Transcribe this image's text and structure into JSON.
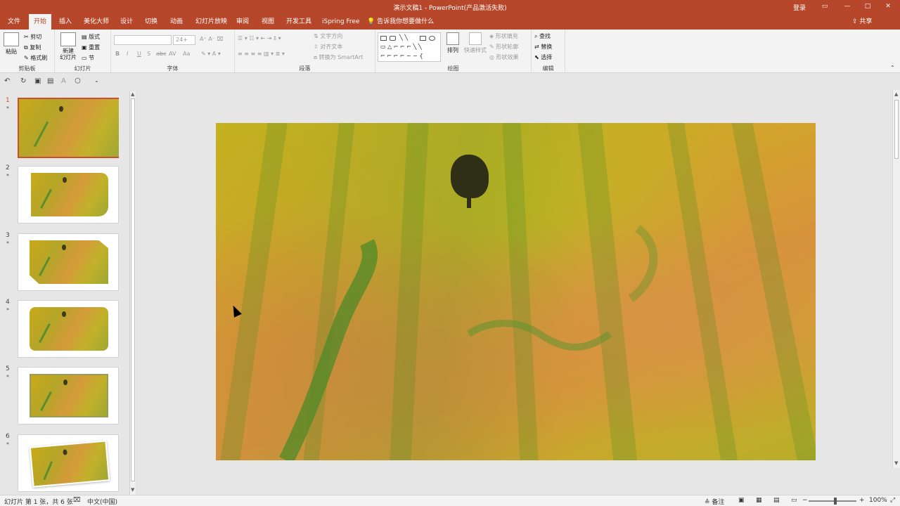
{
  "titlebar": {
    "title": "演示文稿1  -  PowerPoint(产品激活失败)",
    "login": "登录",
    "restore_icon": "ribbon-display-icon",
    "min": "—",
    "max": "□",
    "close": "✕"
  },
  "tabs": [
    "文件",
    "开始",
    "插入",
    "美化大师",
    "设计",
    "切换",
    "动画",
    "幻灯片放映",
    "审阅",
    "视图",
    "开发工具",
    "iSpring Free"
  ],
  "active_tab": "开始",
  "tellme": "告诉我你想要做什么",
  "share": "共享",
  "ribbon": {
    "clipboard": {
      "label": "剪贴板",
      "paste": "粘贴",
      "cut": "剪切",
      "copy": "复制",
      "format_painter": "格式刷"
    },
    "slides": {
      "label": "幻灯片",
      "new_slide": "新建\n幻灯片",
      "layout": "版式",
      "reset": "重置",
      "section": "节"
    },
    "font": {
      "label": "字体",
      "font_name": "",
      "font_size": "24+",
      "bold": "B",
      "italic": "I",
      "underline": "U",
      "shadow": "S",
      "strike": "abc",
      "spacing": "AV",
      "case": "Aa"
    },
    "paragraph": {
      "label": "段落",
      "text_direction": "文字方向",
      "align_text": "对齐文本",
      "smartart": "转换为 SmartArt"
    },
    "drawing": {
      "label": "绘图",
      "arrange": "排列",
      "quick_styles": "快速样式",
      "shape_fill": "形状填充",
      "shape_outline": "形状轮廓",
      "shape_effects": "形状效果"
    },
    "editing": {
      "label": "编辑",
      "find": "查找",
      "replace": "替换",
      "select": "选择"
    }
  },
  "thumbnails": [
    {
      "num": "1",
      "star": "*"
    },
    {
      "num": "2",
      "star": "*"
    },
    {
      "num": "3",
      "star": "*"
    },
    {
      "num": "4",
      "star": "*"
    },
    {
      "num": "5",
      "star": "*"
    },
    {
      "num": "6",
      "star": "*"
    }
  ],
  "status": {
    "slide_info": "幻灯片 第 1 张，共 6 张",
    "language": "中文(中国)",
    "notes": "备注",
    "zoom": "100%"
  }
}
